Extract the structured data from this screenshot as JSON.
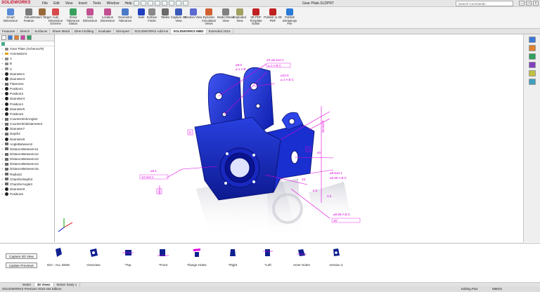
{
  "app": {
    "logo": "SOLIDWORKS",
    "menu": [
      "File",
      "Edit",
      "View",
      "Insert",
      "Tools",
      "Window",
      "Help"
    ],
    "document_title": "Gear Plate.SLDPRT",
    "search_placeholder": "Search Commands"
  },
  "ribbon": {
    "buttons": [
      "Smart Dimension",
      "Datum Feature",
      "Datum Target",
      "Auto Dimension Scheme",
      "Show Tolerance Status",
      "Size Dimension",
      "Location Dimension",
      "Geometric Tolerance",
      "Note",
      "Surface Finish",
      "Tables",
      "Capture 3D View",
      "Section View",
      "Dynamic Annotation Views",
      "Model Break View",
      "Exploded View",
      "3D PDF Template Editor",
      "Publish to 3D PDF",
      "Publish eDrawings File"
    ]
  },
  "tabs": [
    "Features",
    "Sketch",
    "Surfaces",
    "Sheet Metal",
    "Direct Editing",
    "Evaluate",
    "DimXpert",
    "SOLIDWORKS Add-Ins",
    "SOLIDWORKS MBD",
    "Extended 2015"
  ],
  "tree": [
    "Gear Plate (Schema79)",
    "Annotations",
    "A",
    "B",
    "C",
    "Diameter1",
    "Diameter3",
    "Flatness1",
    "Position1",
    "Position3",
    "Diameter4",
    "Position4",
    "Diameter5",
    "Position5",
    "CounterSinkAngle2",
    "CounterSinkDiameter2",
    "Diameter7",
    "Depth2",
    "Diameter8",
    "AngleBetween2",
    "DistanceBetween11",
    "DistanceBetween12",
    "DistanceBetween13",
    "DistanceBetween14",
    "DistanceBetween15",
    "Radius3",
    "ChamferDepth2",
    "ChamferAngle3",
    "Diameter9",
    "Position6"
  ],
  "annotations": [
    "2X ⌀6.4±0.1",
    "⌀.1 A B C",
    "⌀8.0",
    "⌀.1 A B",
    "⌀10.0",
    "⌀.1 A B C",
    "35.0±0.2",
    "40",
    "A",
    "B",
    "C",
    "⌀0.1",
    "12.0±0.1",
    "⌀0.05 A B C",
    "45°",
    "4X",
    "⌀9.6±0.1",
    "⌀0.05 A B C",
    "6.0",
    "3.0"
  ],
  "captures": {
    "capture_button": "Capture 3D View",
    "update_button": "Update Previews",
    "views": [
      "ISO - ALL DIMS",
      "Overview",
      "*Top",
      "*Front",
      "Flange Holes",
      "*Right",
      "*Left",
      "Inner Holes",
      "Version 2"
    ]
  },
  "doc_tabs": [
    "Model",
    "3D Views",
    "Motion Study 1"
  ],
  "status": {
    "edition": "SOLIDWORKS Premium 2015 x64 Edition",
    "mode": "Editing Part",
    "units": "MMGS"
  },
  "colors": {
    "model_blue": "#1a2fd0",
    "annotation_magenta": "#e000e0",
    "brand_red": "#c8102e"
  }
}
